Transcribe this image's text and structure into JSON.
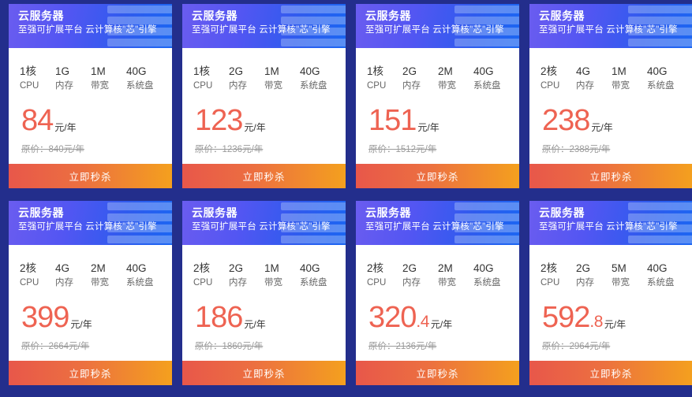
{
  "page": {
    "background_color": "#232e8c",
    "accent_price_color": "#ee6352",
    "header_gradient_from": "#6a5cf0",
    "header_gradient_to": "#1b66f2",
    "button_gradient_from": "#e8574a",
    "button_gradient_to": "#f4a01e"
  },
  "labels": {
    "product_title": "云服务器",
    "product_subtitle": "至强可扩展平台 云计算核\"芯\"引擎",
    "cpu_key": "CPU",
    "memory_key": "内存",
    "bandwidth_key": "带宽",
    "disk_key": "系统盘",
    "price_unit": "元/年",
    "buy_label": "立即秒杀",
    "server_icon": "server-stack-icon"
  },
  "cards": [
    {
      "title": "云服务器",
      "subtitle": "至强可扩展平台 云计算核\"芯\"引擎",
      "cpu": "1核",
      "memory": "1G",
      "bandwidth": "1M",
      "disk": "40G",
      "price_int": "84",
      "price_dec": "",
      "price_unit": "元/年",
      "original_price": "原价：840元/年",
      "buy_label": "立即秒杀"
    },
    {
      "title": "云服务器",
      "subtitle": "至强可扩展平台 云计算核\"芯\"引擎",
      "cpu": "1核",
      "memory": "2G",
      "bandwidth": "1M",
      "disk": "40G",
      "price_int": "123",
      "price_dec": "",
      "price_unit": "元/年",
      "original_price": "原价：1236元/年",
      "buy_label": "立即秒杀"
    },
    {
      "title": "云服务器",
      "subtitle": "至强可扩展平台 云计算核\"芯\"引擎",
      "cpu": "1核",
      "memory": "2G",
      "bandwidth": "2M",
      "disk": "40G",
      "price_int": "151",
      "price_dec": "",
      "price_unit": "元/年",
      "original_price": "原价：1512元/年",
      "buy_label": "立即秒杀"
    },
    {
      "title": "云服务器",
      "subtitle": "至强可扩展平台 云计算核\"芯\"引擎",
      "cpu": "2核",
      "memory": "4G",
      "bandwidth": "1M",
      "disk": "40G",
      "price_int": "238",
      "price_dec": "",
      "price_unit": "元/年",
      "original_price": "原价：2388元/年",
      "buy_label": "立即秒杀"
    },
    {
      "title": "云服务器",
      "subtitle": "至强可扩展平台 云计算核\"芯\"引擎",
      "cpu": "2核",
      "memory": "4G",
      "bandwidth": "2M",
      "disk": "40G",
      "price_int": "399",
      "price_dec": "",
      "price_unit": "元/年",
      "original_price": "原价：2664元/年",
      "buy_label": "立即秒杀"
    },
    {
      "title": "云服务器",
      "subtitle": "至强可扩展平台 云计算核\"芯\"引擎",
      "cpu": "2核",
      "memory": "2G",
      "bandwidth": "1M",
      "disk": "40G",
      "price_int": "186",
      "price_dec": "",
      "price_unit": "元/年",
      "original_price": "原价：1860元/年",
      "buy_label": "立即秒杀"
    },
    {
      "title": "云服务器",
      "subtitle": "至强可扩展平台 云计算核\"芯\"引擎",
      "cpu": "2核",
      "memory": "2G",
      "bandwidth": "2M",
      "disk": "40G",
      "price_int": "320",
      "price_dec": ".4",
      "price_unit": "元/年",
      "original_price": "原价：2136元/年",
      "buy_label": "立即秒杀"
    },
    {
      "title": "云服务器",
      "subtitle": "至强可扩展平台 云计算核\"芯\"引擎",
      "cpu": "2核",
      "memory": "2G",
      "bandwidth": "5M",
      "disk": "40G",
      "price_int": "592",
      "price_dec": ".8",
      "price_unit": "元/年",
      "original_price": "原价：2964元/年",
      "buy_label": "立即秒杀"
    }
  ]
}
